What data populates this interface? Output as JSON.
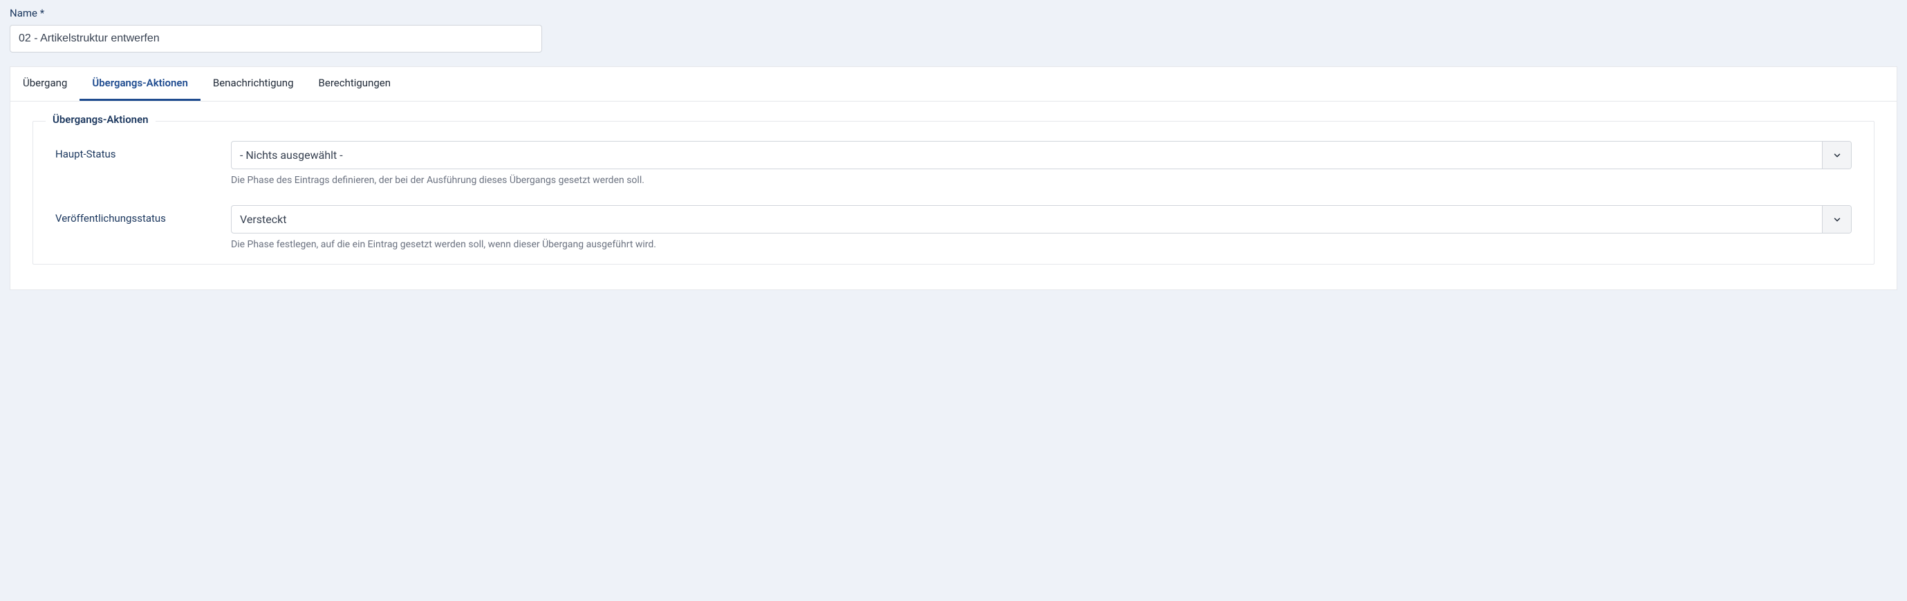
{
  "name_field": {
    "label": "Name *",
    "value": "02 - Artikelstruktur entwerfen"
  },
  "tabs": [
    {
      "label": "Übergang",
      "active": false
    },
    {
      "label": "Übergangs-Aktionen",
      "active": true
    },
    {
      "label": "Benachrichtigung",
      "active": false
    },
    {
      "label": "Berechtigungen",
      "active": false
    }
  ],
  "fieldset": {
    "legend": "Übergangs-Aktionen",
    "fields": {
      "haupt_status": {
        "label": "Haupt-Status",
        "value": "- Nichts ausgewählt -",
        "help": "Die Phase des Eintrags definieren, der bei der Ausführung dieses Übergangs gesetzt werden soll."
      },
      "veroeff_status": {
        "label": "Veröffentlichungsstatus",
        "value": "Versteckt",
        "help": "Die Phase festlegen, auf die ein Eintrag gesetzt werden soll, wenn dieser Übergang ausgeführt wird."
      }
    }
  }
}
